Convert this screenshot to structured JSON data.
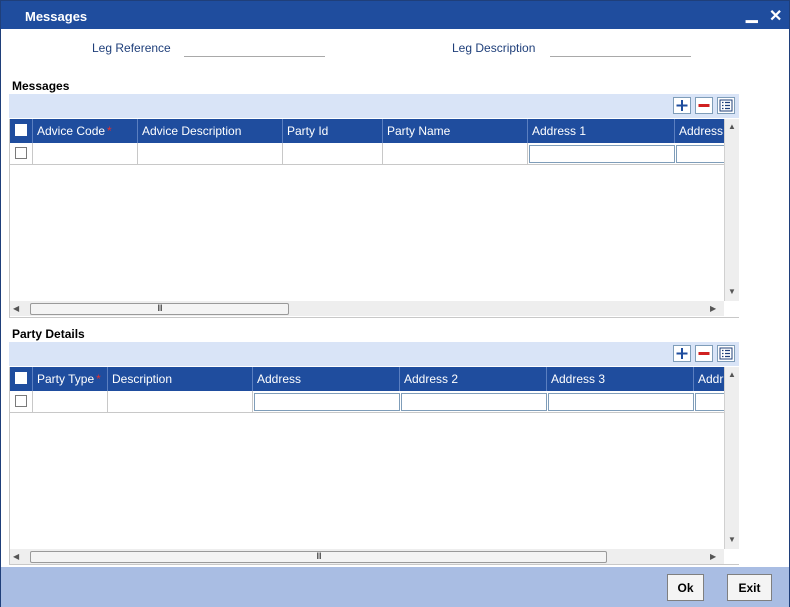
{
  "window": {
    "title": "Messages",
    "minimize": "▁",
    "close": "✕"
  },
  "header": {
    "leg_reference_label": "Leg Reference",
    "leg_reference_value": "",
    "leg_description_label": "Leg Description",
    "leg_description_value": ""
  },
  "messages": {
    "section_title": "Messages",
    "toolbar": {
      "add_icon": "plus-icon",
      "delete_icon": "minus-icon",
      "view_icon": "list-view-icon"
    },
    "columns": [
      "Advice Code",
      "Advice Description",
      "Party Id",
      "Party Name",
      "Address 1",
      "Address"
    ],
    "required_marker": "*",
    "rows": [
      [
        "",
        "",
        "",
        "",
        "",
        ""
      ]
    ]
  },
  "party_details": {
    "section_title": "Party Details",
    "toolbar": {
      "add_icon": "plus-icon",
      "delete_icon": "minus-icon",
      "view_icon": "list-view-icon"
    },
    "columns": [
      "Party Type",
      "Description",
      "Address",
      "Address 2",
      "Address 3",
      "Addr"
    ],
    "required_marker": "*",
    "rows": [
      [
        "",
        "",
        "",
        "",
        "",
        ""
      ]
    ]
  },
  "scroll_grip": "III",
  "footer": {
    "ok_label": "Ok",
    "exit_label": "Exit"
  },
  "colors": {
    "accent": "#1f4d9e",
    "toolbar_bg": "#d9e4f7",
    "footer_bg": "#a9bde3",
    "required": "#e03030"
  }
}
